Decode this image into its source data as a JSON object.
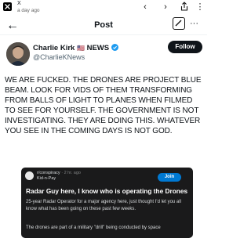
{
  "browser": {
    "site_title": "X",
    "subtitle": "a day ago"
  },
  "header": {
    "title": "Post"
  },
  "post": {
    "author": {
      "name": "Charlie Kirk",
      "emoji": "🇺🇸",
      "news_label": "NEWS",
      "handle": "@CharlieKNews"
    },
    "follow_label": "Follow",
    "text": "WE ARE FUCKED. THE DRONES ARE PROJECT BLUE BEAM. LOOK FOR VIDS OF THEM TRANSFORMING FROM BALLS OF LIGHT TO PLANES WHEN FILMED TO SEE FOR YOURSELF. THE GOVERNMENT IS NOT INVESTIGATING. THEY ARE DOING THIS. WHATEVER YOU SEE IN THE COMING DAYS IS NOT GOD."
  },
  "reddit_card": {
    "subreddit": "r/conspiracy",
    "time": "2 hr. ago",
    "username": "Kid-n-Pay",
    "join_label": "Join",
    "title": "Radar Guy here, I know who is operating the Drones",
    "body": "25-year Radar Operator for a major agency here, just thought I'd let you all know what has been going on these past few weeks.",
    "body_more": "The drones are part of a military \"drill\" being conducted by space"
  },
  "colors": {
    "verified": "#1d9bf0",
    "join": "#0079d3",
    "card_bg": "#1a1a1b"
  }
}
